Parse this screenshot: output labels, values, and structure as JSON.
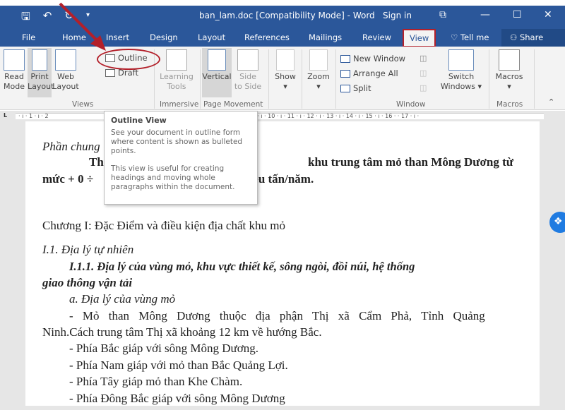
{
  "titlebar": {
    "title": "ban_lam.doc [Compatibility Mode]  -  Word",
    "sign_in": "Sign in",
    "icons": [
      "save-icon",
      "undo-icon",
      "redo-icon",
      "customize-qat-icon"
    ],
    "window_controls": {
      "ribbon_display": "⧉",
      "minimize": "—",
      "maximize": "☐",
      "close": "✕"
    }
  },
  "tabs": [
    {
      "label": "File"
    },
    {
      "label": "Home"
    },
    {
      "label": "Insert"
    },
    {
      "label": "Design"
    },
    {
      "label": "Layout"
    },
    {
      "label": "References"
    },
    {
      "label": "Mailings"
    },
    {
      "label": "Review"
    },
    {
      "label": "View",
      "active": true
    }
  ],
  "tell_me": "Tell me",
  "share": "Share",
  "ribbon": {
    "views": {
      "read_mode": "Read Mode",
      "read_mode_1": "Read",
      "read_mode_2": "Mode",
      "print_layout_1": "Print",
      "print_layout_2": "Layout",
      "web_layout_1": "Web",
      "web_layout_2": "Layout",
      "outline": "Outline",
      "draft": "Draft",
      "group": "Views"
    },
    "immersive": {
      "learning_tools_1": "Learning",
      "learning_tools_2": "Tools",
      "group": "Immersive"
    },
    "page_movement": {
      "vertical": "Vertical",
      "side_1": "Side",
      "side_2": "to Side",
      "group": "Page Movement"
    },
    "show": "Show",
    "zoom": "Zoom",
    "window": {
      "new_window": "New Window",
      "arrange_all": "Arrange All",
      "split": "Split",
      "switch_1": "Switch",
      "switch_2": "Windows",
      "group": "Window"
    },
    "macros": {
      "label": "Macros",
      "group": "Macros"
    }
  },
  "ruler": {
    "left": "· ı · 1 · ı · 2",
    "right": "8 · ı · 9 · ı · 10 · ı · 11 · ı · 12 · ı · 13 · ı · 14 · ı · 15 · ı · 16 ·  · 17 · ı ·"
  },
  "tooltip": {
    "title": "Outline View",
    "p1": "See your document in outline form where content is shown as bulleted points.",
    "p2": "This view is useful for creating headings and moving whole paragraphs within the document."
  },
  "document": {
    "l1": "Phần chung",
    "l2a": "Thiết",
    "l2b": "khu trung tâm mỏ than Mông Dương từ",
    "l3a": "mức + 0 ÷",
    "l3b": "riệu tấn/năm.",
    "l4": "Chương I: Đặc Điểm và điều kiện địa chất khu mỏ",
    "l5": "I.1. Địa lý tự  nhiên",
    "l6": "I.1.1. Địa lý của vùng mỏ, khu vực thiết kế, sông ngòi, đồi núi, hệ thống",
    "l7": "giao thông vận tải",
    "l8": "a. Địa lý của vùng mỏ",
    "l9": "- Mỏ than Mông Dương thuộc địa phận Thị xã Cẩm Phả, Tỉnh Quảng",
    "l10": "Ninh.Cách trung tâm Thị xã khoảng 12 km về hướng Bắc.",
    "l11": "- Phía Bắc giáp với sông Mông Dương.",
    "l12": "- Phía Nam giáp với mỏ than Bắc Quảng Lợi.",
    "l13": "- Phía Tây giáp mỏ than Khe Chàm.",
    "l14": "- Phía Đông Bắc giáp với sông Mông Dương"
  },
  "colors": {
    "word_blue": "#2b579a",
    "annotation_red": "#b3202a",
    "dropbox_blue": "#1f7be1"
  }
}
